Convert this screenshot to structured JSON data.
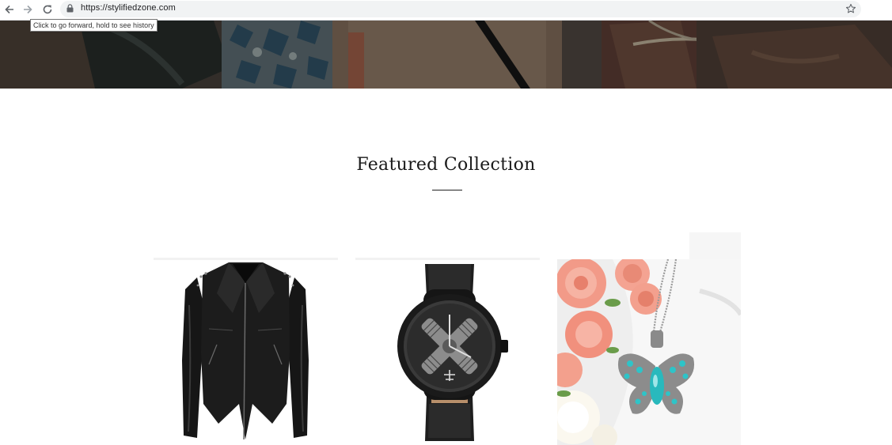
{
  "browser": {
    "url": "https://stylifiedzone.com",
    "tooltip": "Click to go forward, hold to see history"
  },
  "icons": {
    "back": "arrow-left-icon",
    "forward": "arrow-right-icon",
    "reload": "reload-icon",
    "lock": "lock-icon",
    "bookmark": "star-icon"
  },
  "main": {
    "section_title": "Featured Collection"
  },
  "products": [
    {
      "image": "black-leather-jacket"
    },
    {
      "image": "aviator-engine-watch"
    },
    {
      "image": "butterfly-turquoise-necklace"
    }
  ],
  "colors": {
    "hero_bg": "#3f3a35",
    "page_bg": "#ffffff",
    "title": "#1a1a1a",
    "necklace_stone": "#2ec4c8"
  }
}
